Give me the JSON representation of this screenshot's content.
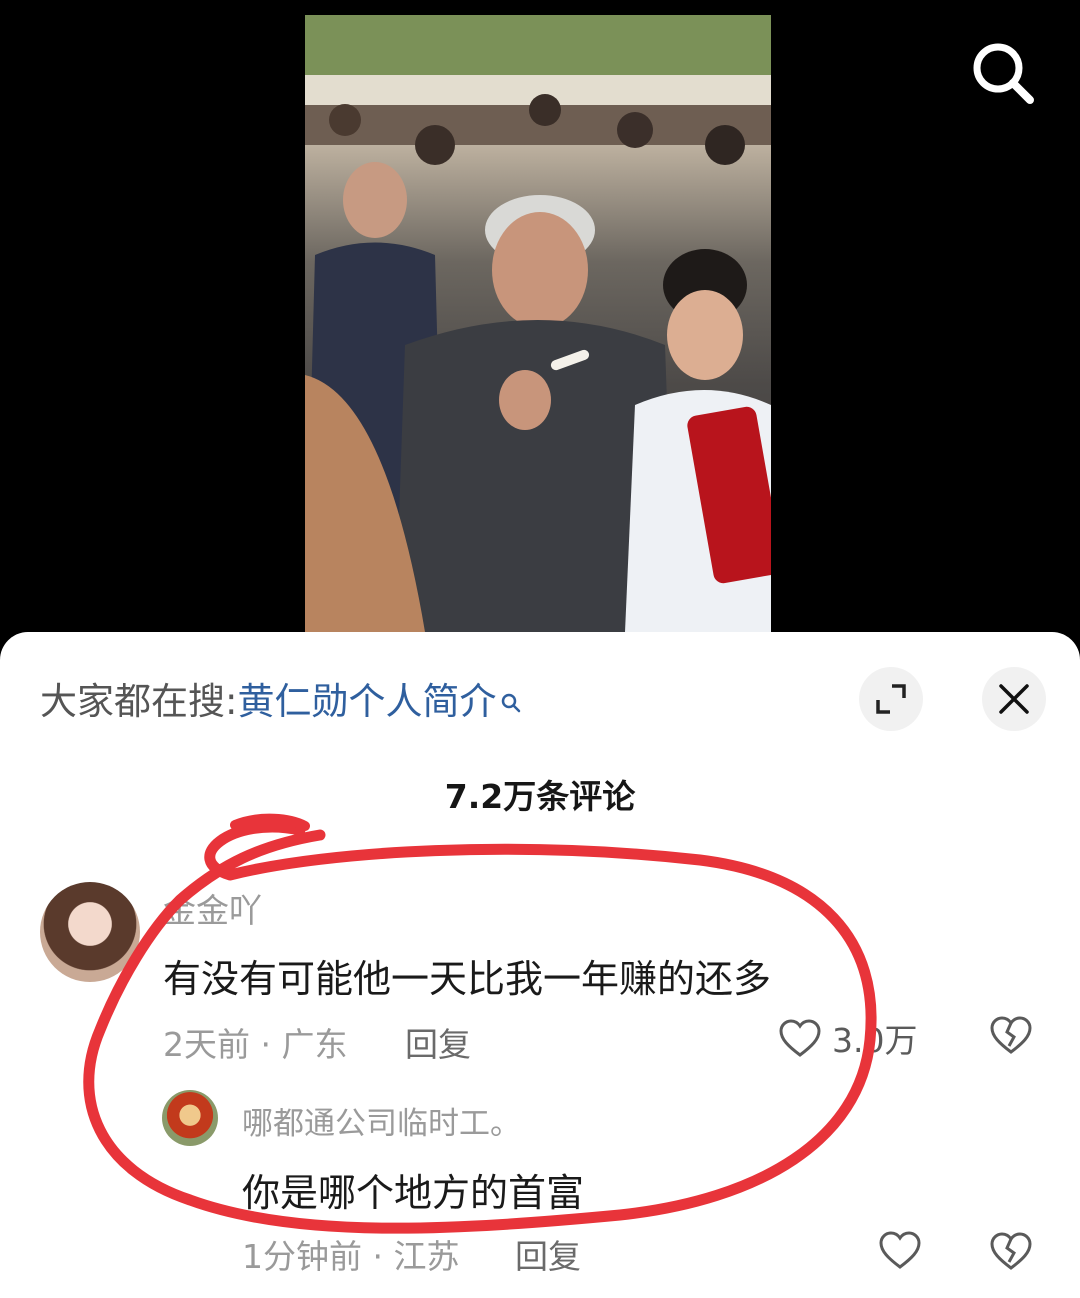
{
  "video": {
    "search_icon": "search-icon"
  },
  "sheet": {
    "hot_search_prefix": "大家都在搜",
    "hot_search_colon": ":",
    "hot_search_term": "黄仁勋个人简介",
    "expand_icon": "expand-icon",
    "close_icon": "close-icon",
    "comment_count": "7.2万条评论",
    "link_color": "#2f5f9e"
  },
  "comments": [
    {
      "username": "金金吖",
      "text": "有没有可能他一天比我一年赚的还多",
      "meta": "2天前 · 广东",
      "reply_label": "回复",
      "like_count": "3.0万"
    }
  ],
  "reply": {
    "username": "哪都通公司临时工。",
    "text": "你是哪个地方的首富",
    "meta": "1分钟前 · 江苏",
    "reply_label": "回复"
  },
  "annotation_color": "#e8343a"
}
